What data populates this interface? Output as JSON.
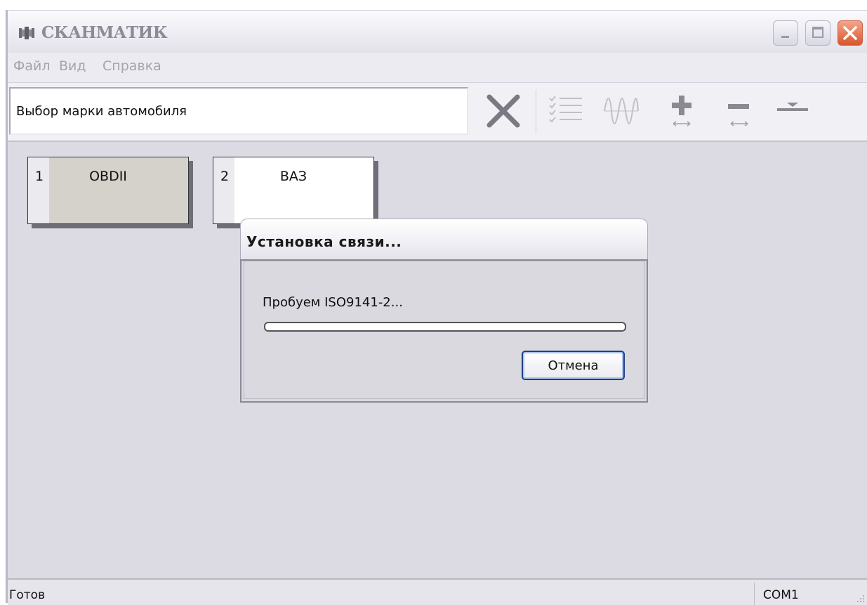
{
  "window": {
    "title": "СКАНМАТИК",
    "controls": [
      "minimize-icon",
      "maximize-icon",
      "close-icon"
    ]
  },
  "menu": {
    "items": [
      "Файл",
      "Вид",
      "Справка"
    ]
  },
  "toolbar": {
    "combo_value": "Выбор марки автомобиля",
    "icons": [
      "close-x-icon",
      "checklist-icon",
      "waveform-icon",
      "plus-icon",
      "minus-icon",
      "underline-icon"
    ]
  },
  "tiles": [
    {
      "number": "1",
      "name": "OBDII"
    },
    {
      "number": "2",
      "name": "ВАЗ"
    }
  ],
  "dialog": {
    "title": "Установка связи...",
    "message": "Пробуем ISO9141-2...",
    "progress": 0,
    "cancel_label": "Отмена"
  },
  "status": {
    "text": "Готов",
    "port": "COM1"
  },
  "colors": {
    "close_button": "#d9552d",
    "tile1_fill": "#d5d1cb",
    "progress_fill": "#4a7fd6",
    "default_button_border": "#1f3f86"
  }
}
